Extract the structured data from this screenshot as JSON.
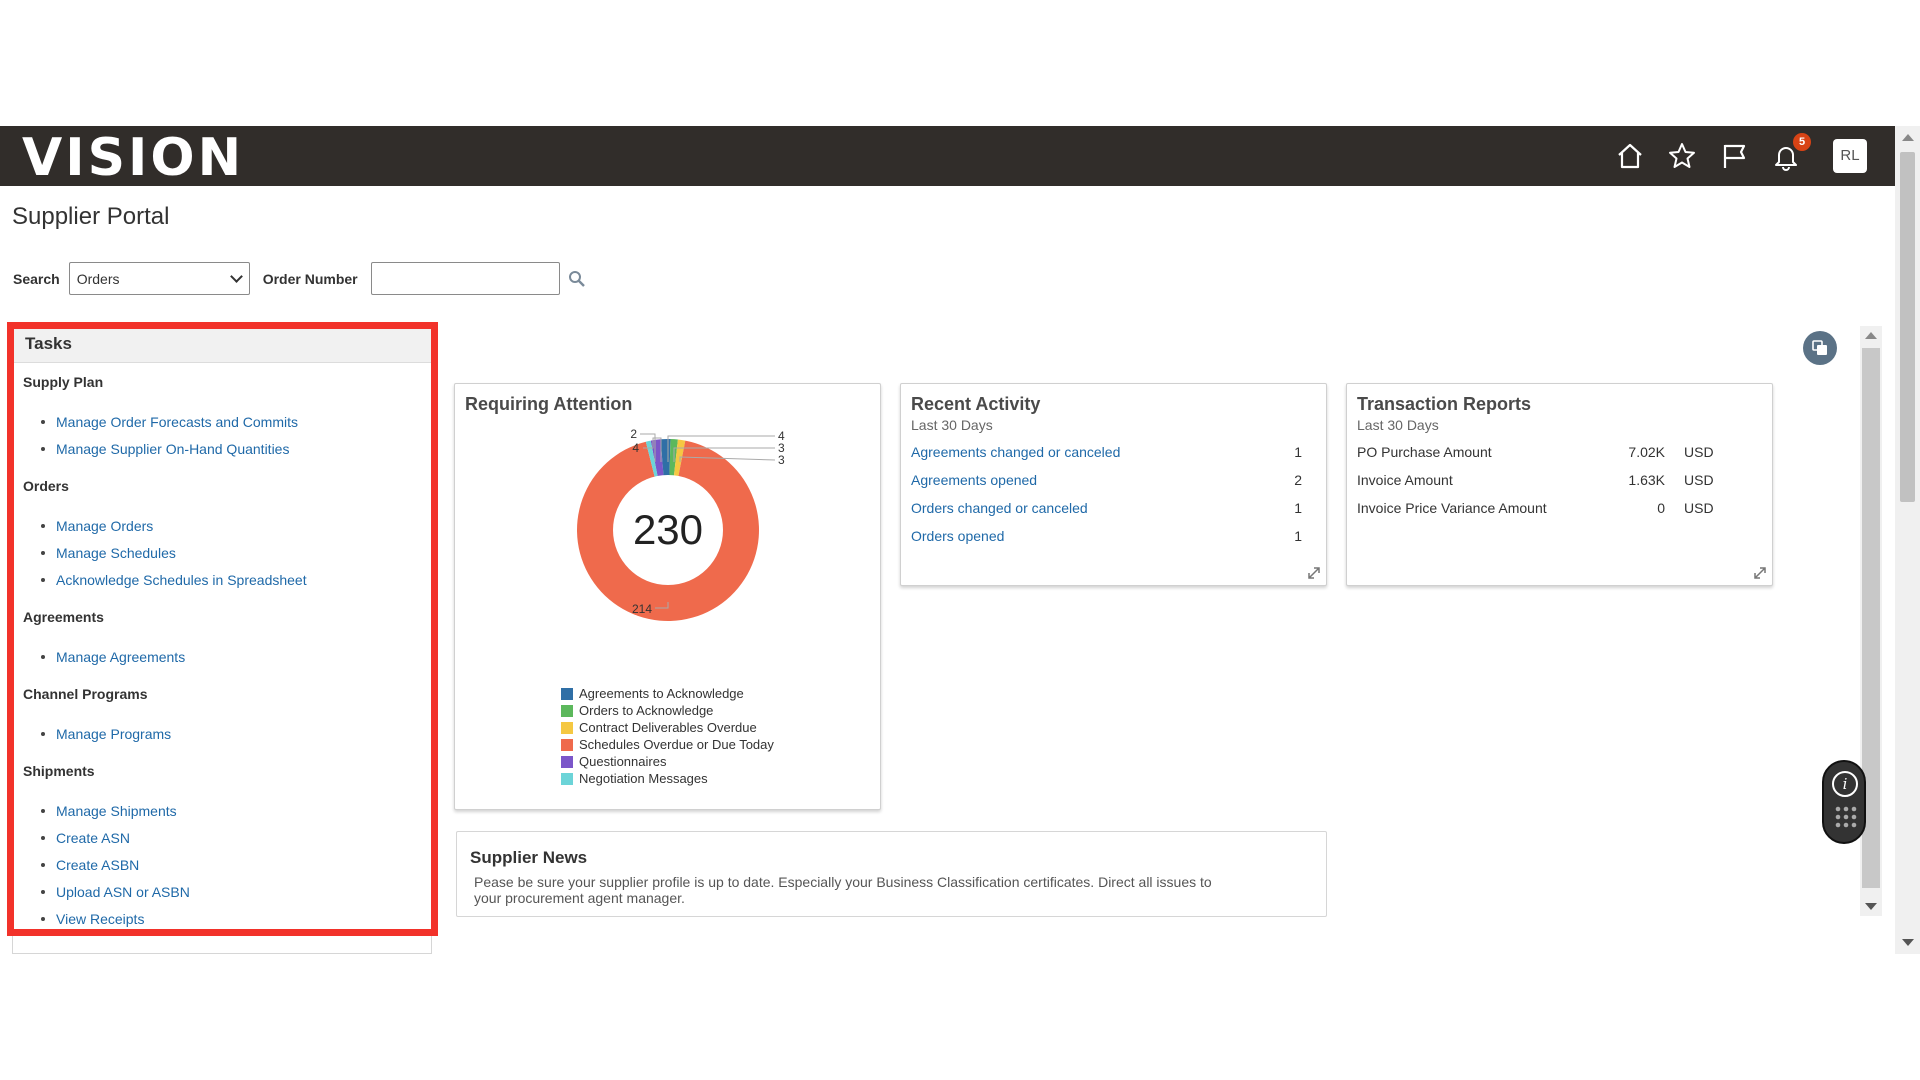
{
  "header": {
    "logo": "VISION",
    "notification_count": "5",
    "user_initials": "RL",
    "icons": [
      "home-icon",
      "star-icon",
      "flag-icon",
      "bell-icon"
    ]
  },
  "page": {
    "title": "Supplier Portal"
  },
  "search": {
    "label": "Search",
    "selected": "Orders",
    "order_number_label": "Order Number",
    "order_number_value": ""
  },
  "tasks": {
    "title": "Tasks",
    "groups": [
      {
        "title": "Supply Plan",
        "items": [
          "Manage Order Forecasts and Commits",
          "Manage Supplier On-Hand Quantities"
        ]
      },
      {
        "title": "Orders",
        "items": [
          "Manage Orders",
          "Manage Schedules",
          "Acknowledge Schedules in Spreadsheet"
        ]
      },
      {
        "title": "Agreements",
        "items": [
          "Manage Agreements"
        ]
      },
      {
        "title": "Channel Programs",
        "items": [
          "Manage Programs"
        ]
      },
      {
        "title": "Shipments",
        "items": [
          "Manage Shipments",
          "Create ASN",
          "Create ASBN",
          "Upload ASN or ASBN",
          "View Receipts"
        ]
      }
    ]
  },
  "requiring_attention": {
    "title": "Requiring Attention",
    "total": "230",
    "callouts": {
      "c214": "214",
      "c2": "2",
      "c4a": "4",
      "c4b": "4",
      "c3a": "3",
      "c3b": "3"
    }
  },
  "chart_data": {
    "type": "pie",
    "title": "Requiring Attention",
    "center_label": "230",
    "categories": [
      "Agreements to Acknowledge",
      "Orders to Acknowledge",
      "Contract Deliverables Overdue",
      "Schedules Overdue or Due Today",
      "Questionnaires",
      "Negotiation Messages"
    ],
    "values": [
      4,
      3,
      3,
      214,
      4,
      2
    ],
    "colors": [
      "#2f6fa6",
      "#5cb85c",
      "#f5c842",
      "#ef6a4c",
      "#7b56c9",
      "#6cd4d8"
    ],
    "legend_position": "bottom"
  },
  "recent_activity": {
    "title": "Recent Activity",
    "subtitle": "Last 30 Days",
    "rows": [
      {
        "label": "Agreements changed or canceled",
        "count": "1"
      },
      {
        "label": "Agreements opened",
        "count": "2"
      },
      {
        "label": "Orders changed or canceled",
        "count": "1"
      },
      {
        "label": "Orders opened",
        "count": "1"
      }
    ]
  },
  "transaction_reports": {
    "title": "Transaction Reports",
    "subtitle": "Last 30 Days",
    "rows": [
      {
        "label": "PO Purchase Amount",
        "value": "7.02K",
        "currency": "USD"
      },
      {
        "label": "Invoice Amount",
        "value": "1.63K",
        "currency": "USD"
      },
      {
        "label": "Invoice Price Variance Amount",
        "value": "0",
        "currency": "USD"
      }
    ]
  },
  "supplier_news": {
    "title": "Supplier News",
    "text": "Pease be sure your supplier profile is up to date.  Especially your Business Classification certificates.  Direct all issues to your procurement agent manager."
  },
  "colors": {
    "header_bg": "#312d2a",
    "link": "#1f69a8",
    "highlight": "#f2322a",
    "badge": "#d84315"
  }
}
